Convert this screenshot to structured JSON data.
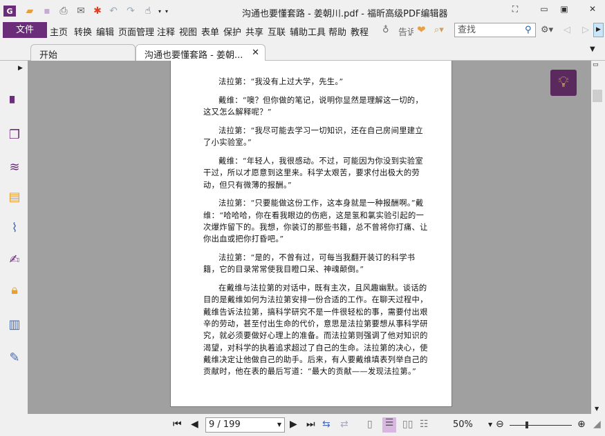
{
  "window": {
    "title": "沟通也要懂套路 - 姜朝川.pdf - 福昕高级PDF编辑器"
  },
  "menu": {
    "file": "文件",
    "items": [
      "主页",
      "转换",
      "编辑",
      "页面管理",
      "注释",
      "视图",
      "表单",
      "保护",
      "共享",
      "互联",
      "辅助工具",
      "帮助",
      "教程"
    ],
    "tell_me": "告诉",
    "search_placeholder": "查找"
  },
  "tabs": [
    {
      "label": "开始"
    },
    {
      "label": "沟通也要懂套路 - 姜朝..."
    }
  ],
  "document": {
    "paragraphs": [
      [
        "法拉第：“我没有上过大学，先生。”"
      ],
      [
        "戴维：“噢？但你做的笔记，说明你显然是理解这一切的，",
        "这又怎么解释呢？”"
      ],
      [
        "法拉第：“我尽可能去学习一切知识，还在自己房间里建立",
        "了小实验室。”"
      ],
      [
        "戴维：“年轻人，我很感动。不过，可能因为你没到实验室",
        "干过，所以才愿意到这里来。科学太艰苦，要求付出极大的劳",
        "动，但只有微薄的报酬。”"
      ],
      [
        "法拉第：“只要能做这份工作，这本身就是一种报酬啊。”戴",
        "维：“哈哈哈，你在看我眼边的伤疤，这是氢和氯实验引起的一",
        "次爆炸留下的。我想，你装订的那些书籍，总不曾将你打痛、让",
        "你出血或把你打昏吧。”"
      ],
      [
        "法拉第：“是的，不曾有过，可每当我翻开装订的科学书",
        "籍，它的目录常常使我目瞪口呆、神魂颠倒。”"
      ],
      [
        "在戴维与法拉第的对话中，既有主次，且风趣幽默。谈话的",
        "目的是戴维如何为法拉第安排一份合适的工作。在聊天过程中，",
        "戴维告诉法拉第，搞科学研究不是一件很轻松的事，需要付出艰",
        "辛的劳动，甚至付出生命的代价，意思是法拉第要想从事科学研",
        "究，就必须要做好心理上的准备。而法拉第则强调了他对知识的",
        "渴望，对科学的执着追求超过了自己的生命。法拉第的决心，使",
        "戴维决定让他做自己的助手。后来，有人要戴维填表列举自己的",
        "贡献时，他在表的最后写道：“最大的贡献——发现法拉第。”"
      ]
    ]
  },
  "status": {
    "page": "9 / 199",
    "zoom": "50%"
  },
  "colors": {
    "accent": "#6b2c7a",
    "canvas": "#a0a0a0"
  }
}
